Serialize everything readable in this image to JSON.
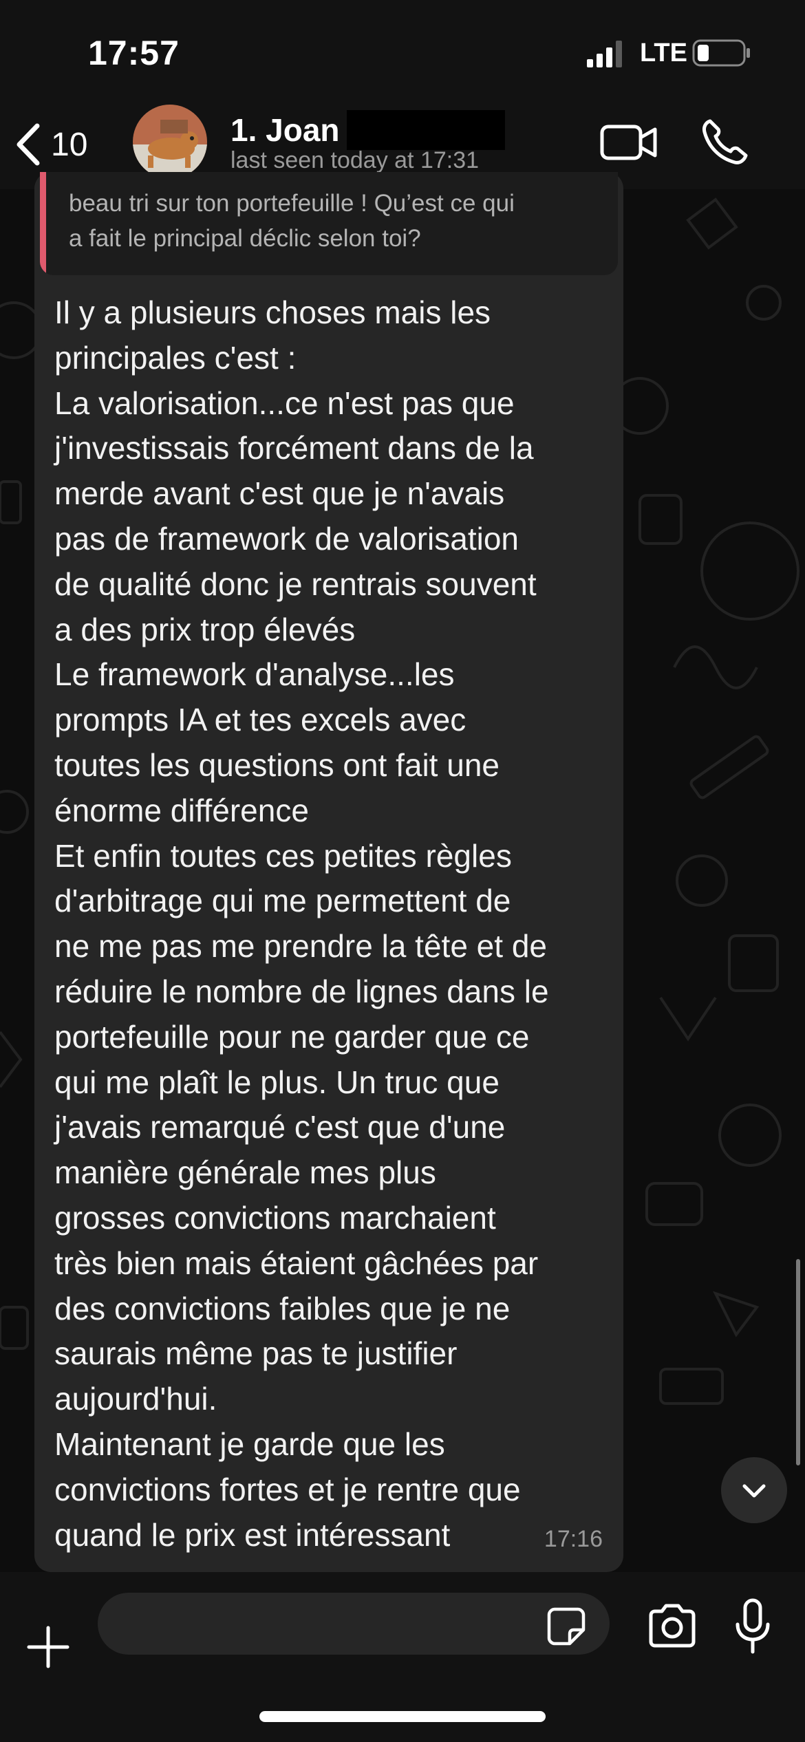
{
  "status_bar": {
    "time": "17:57",
    "network": "LTE"
  },
  "header": {
    "back_count": "10",
    "contact_name": "1. Joan",
    "contact_status": "last seen today at 17:31"
  },
  "message": {
    "quoted_text": "beau tri sur ton portefeuille ! Qu’est ce qui\na fait le principal déclic selon toi?",
    "text": "Il y a plusieurs choses mais les\nprincipales c'est :\nLa valorisation...ce n'est pas que\nj'investissais forcément dans de la\nmerde avant c'est que je n'avais\npas de framework de valorisation\nde qualité donc je rentrais souvent\na des prix trop élevés\nLe framework d'analyse...les\nprompts IA et tes excels avec\ntoutes les questions ont fait une\nénorme différence\nEt enfin toutes ces petites règles\nd'arbitrage qui me permettent de\nne me pas me prendre la tête et de\nréduire le nombre de lignes dans le\nportefeuille pour ne garder que ce\nqui me plaît le plus. Un truc que\nj'avais remarqué c'est que d'une\nmanière générale mes plus\ngrosses convictions marchaient\ntrès bien mais étaient gâchées par\ndes convictions faibles que je ne\nsaurais même pas te justifier\naujourd'hui.\nMaintenant je garde que les\nconvictions fortes et je rentre que\nquand le prix est intéressant",
    "time": "17:16"
  },
  "composer": {
    "placeholder": ""
  },
  "colors": {
    "background": "#0d0d0d",
    "bar": "#121212",
    "bubble": "#262626",
    "quote_accent": "#e05a6d",
    "secondary_text": "#9a9a9a"
  },
  "icons": {
    "back": "chevron-left-icon",
    "video_call": "video-camera-icon",
    "voice_call": "phone-icon",
    "attach": "plus-icon",
    "sticker": "sticker-icon",
    "camera": "camera-icon",
    "mic": "microphone-icon",
    "scroll_down": "chevron-down-icon"
  }
}
